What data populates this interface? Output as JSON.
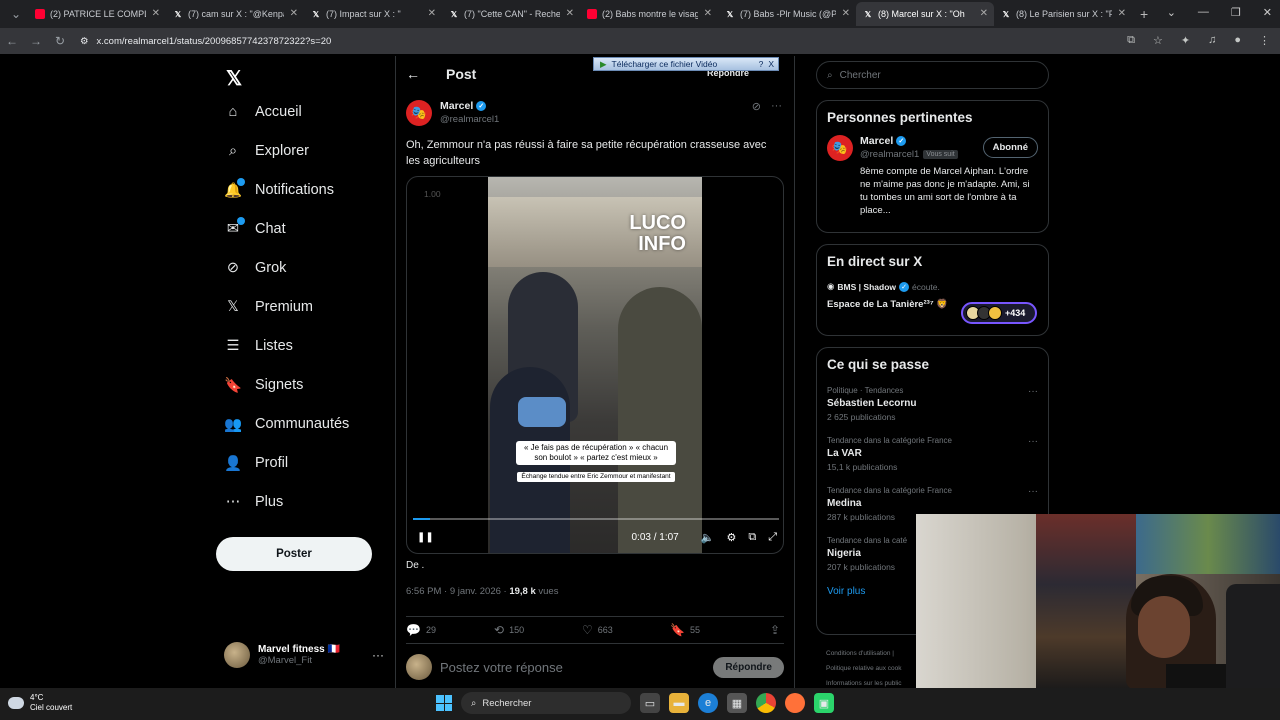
{
  "browser": {
    "tabs": [
      {
        "title": "(2) PATRICE LE COMPLOTI",
        "type": "yt"
      },
      {
        "title": "(7) cam sur X : \"@Kenpac",
        "type": "x"
      },
      {
        "title": "(7) Impact sur X : \"",
        "type": "x"
      },
      {
        "title": "(7) \"Cette CAN\" - Recherc",
        "type": "x"
      },
      {
        "title": "(2) Babs montre le visage",
        "type": "yt"
      },
      {
        "title": "(7) Babs -Plr Music (@Plr",
        "type": "x"
      },
      {
        "title": "(8) Marcel sur X : \"Oh",
        "type": "x",
        "active": true
      },
      {
        "title": "(8) Le Parisien sur X : \"Pa",
        "type": "x"
      }
    ],
    "url": "x.com/realmarcel1/status/2009685774237872322?s=20",
    "new_tab": "+",
    "win_controls": [
      "⌄",
      "—",
      "❐",
      "✕"
    ]
  },
  "nav": {
    "logo": "𝕏",
    "items": [
      {
        "label": "Accueil",
        "icon": "⌂",
        "name": "home"
      },
      {
        "label": "Explorer",
        "icon": "⌕",
        "name": "explore"
      },
      {
        "label": "Notifications",
        "icon": "🔔",
        "name": "notifications",
        "dot": true
      },
      {
        "label": "Chat",
        "icon": "✉",
        "name": "chat",
        "dot": true
      },
      {
        "label": "Grok",
        "icon": "⊘",
        "name": "grok"
      },
      {
        "label": "Premium",
        "icon": "𝕏",
        "name": "premium"
      },
      {
        "label": "Listes",
        "icon": "☰",
        "name": "lists"
      },
      {
        "label": "Signets",
        "icon": "🔖",
        "name": "bookmarks"
      },
      {
        "label": "Communautés",
        "icon": "👥",
        "name": "communities"
      },
      {
        "label": "Profil",
        "icon": "👤",
        "name": "profile"
      },
      {
        "label": "Plus",
        "icon": "⋯",
        "name": "more"
      }
    ],
    "post_button": "Poster",
    "me": {
      "name": "Marvel fitness 🇫🇷",
      "handle": "@Marvel_Fit",
      "more": "···"
    }
  },
  "post": {
    "header_title": "Post",
    "back": "←",
    "download_bar": "Télécharger ce fichier Vidéo",
    "download_help": "?",
    "download_close": "X",
    "repondre_top": "Répondre",
    "author": {
      "name": "Marcel",
      "handle": "@realmarcel1"
    },
    "text": "Oh, Zemmour n'a pas réussi à faire sa petite récupération crasseuse avec les agriculteurs",
    "video": {
      "speed": "1.00",
      "watermark_line1": "LUCO",
      "watermark_line2": "INFO",
      "caption_main": "« Je fais pas de récupération » « chacun son boulot » « partez c'est mieux »",
      "caption_sub": "Échange tendue entre Eric Zemmour et manifestant",
      "progress": 0.047,
      "time": "0:03 / 1:07"
    },
    "from": "De .",
    "meta_time": "6:56 PM · 9 janv. 2026 · ",
    "meta_views": "19,8 k",
    "meta_views_label": " vues",
    "engagement": {
      "replies": "29",
      "reposts": "150",
      "likes": "663",
      "bookmarks": "55"
    },
    "reply_placeholder": "Postez votre réponse",
    "reply_button": "Répondre"
  },
  "right": {
    "search_placeholder": "Chercher",
    "relevant": {
      "title": "Personnes pertinentes",
      "name": "Marcel",
      "handle": "@realmarcel1",
      "follows_you": "Vous suit",
      "follow_button": "Abonné",
      "bio": "8ème compte de Marcel Aiphan. L'ordre ne m'aime pas donc je m'adapte. Ami, si tu tombes un ami sort de l'ombre à ta place..."
    },
    "live": {
      "title": "En direct sur X",
      "host": "BMS | Shadow",
      "listening": "écoute.",
      "space_title": "Espace de La Tanière²³⁷ 🦁",
      "listeners": "+434"
    },
    "happening": {
      "title": "Ce qui se passe",
      "trends": [
        {
          "category": "Politique · Tendances",
          "title": "Sébastien Lecornu",
          "count": "2 625 publications"
        },
        {
          "category": "Tendance dans la catégorie France",
          "title": "La VAR",
          "count": "15,1 k publications"
        },
        {
          "category": "Tendance dans la catégorie France",
          "title": "Medina",
          "count": "287 k publications"
        },
        {
          "category": "Tendance dans la caté",
          "title": "Nigeria",
          "count": "207 k publications"
        }
      ],
      "see_more": "Voir plus"
    },
    "footer": [
      "Conditions d'utilisation |",
      "Politique relative aux cook",
      "Informations sur les public"
    ]
  },
  "taskbar": {
    "temp": "4°C",
    "weather": "Ciel couvert",
    "search": "Rechercher"
  }
}
